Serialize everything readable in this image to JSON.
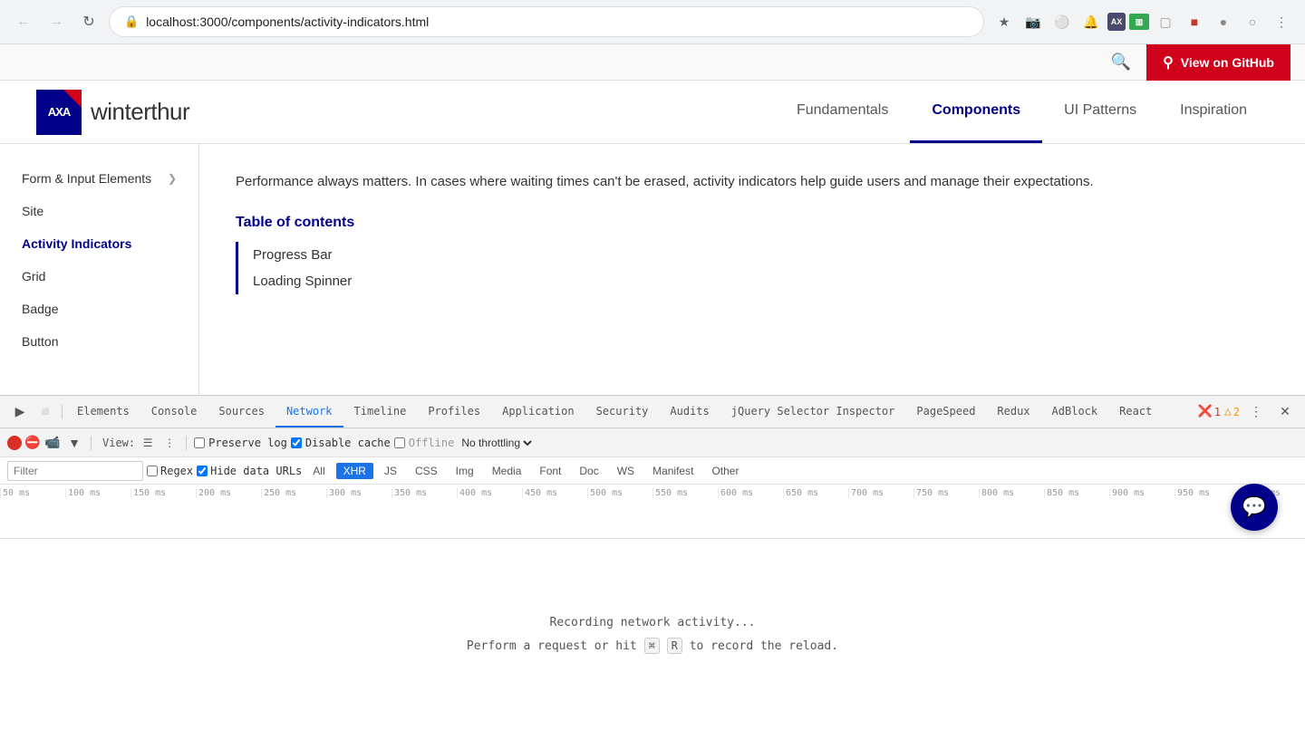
{
  "browser": {
    "url": "localhost:3000/components/activity-indicators.html",
    "back_disabled": true,
    "forward_disabled": true
  },
  "utility_bar": {
    "search_label": "🔍",
    "github_btn_label": "View on GitHub"
  },
  "header": {
    "logo_text": "winterthur",
    "nav_items": [
      {
        "id": "fundamentals",
        "label": "Fundamentals",
        "active": false
      },
      {
        "id": "components",
        "label": "Components",
        "active": true
      },
      {
        "id": "ui-patterns",
        "label": "UI Patterns",
        "active": false
      },
      {
        "id": "inspiration",
        "label": "Inspiration",
        "active": false
      }
    ]
  },
  "sidebar": {
    "items": [
      {
        "id": "form-input",
        "label": "Form & Input Elements",
        "has_chevron": true,
        "active": false
      },
      {
        "id": "site",
        "label": "Site",
        "active": false
      },
      {
        "id": "activity-indicators",
        "label": "Activity Indicators",
        "active": true
      },
      {
        "id": "grid",
        "label": "Grid",
        "active": false
      },
      {
        "id": "badge",
        "label": "Badge",
        "active": false
      },
      {
        "id": "button",
        "label": "Button",
        "active": false
      }
    ]
  },
  "content": {
    "intro": "Performance always matters. In cases where waiting times can't be erased, activity indicators help guide users and manage their expectations.",
    "toc_title": "Table of contents",
    "toc_items": [
      {
        "id": "progress-bar",
        "label": "Progress Bar"
      },
      {
        "id": "loading-spinner",
        "label": "Loading Spinner"
      }
    ]
  },
  "chat_btn": "💬",
  "devtools": {
    "tabs": [
      {
        "id": "elements",
        "label": "Elements",
        "active": false
      },
      {
        "id": "console",
        "label": "Console",
        "active": false
      },
      {
        "id": "sources",
        "label": "Sources",
        "active": false
      },
      {
        "id": "network",
        "label": "Network",
        "active": true
      },
      {
        "id": "timeline",
        "label": "Timeline",
        "active": false
      },
      {
        "id": "profiles",
        "label": "Profiles",
        "active": false
      },
      {
        "id": "application",
        "label": "Application",
        "active": false
      },
      {
        "id": "security",
        "label": "Security",
        "active": false
      },
      {
        "id": "audits",
        "label": "Audits",
        "active": false
      },
      {
        "id": "jquery-selector-inspector",
        "label": "jQuery Selector Inspector",
        "active": false
      },
      {
        "id": "pagespeed",
        "label": "PageSpeed",
        "active": false
      },
      {
        "id": "redux",
        "label": "Redux",
        "active": false
      },
      {
        "id": "adblock",
        "label": "AdBlock",
        "active": false
      },
      {
        "id": "react",
        "label": "React",
        "active": false
      }
    ],
    "error_count": "1",
    "warning_count": "2",
    "network_toolbar": {
      "view_label": "View:",
      "preserve_log_label": "Preserve log",
      "preserve_log_checked": false,
      "disable_cache_label": "Disable cache",
      "disable_cache_checked": true,
      "offline_label": "Offline",
      "offline_checked": false,
      "throttle_label": "No throttling"
    },
    "filter_bar": {
      "placeholder": "Filter",
      "regex_label": "Regex",
      "regex_checked": false,
      "hide_data_urls_label": "Hide data URLs",
      "hide_data_urls_checked": true,
      "filter_tags": [
        {
          "id": "all",
          "label": "All",
          "active": false
        },
        {
          "id": "xhr",
          "label": "XHR",
          "active": true
        },
        {
          "id": "js",
          "label": "JS",
          "active": false
        },
        {
          "id": "css",
          "label": "CSS",
          "active": false
        },
        {
          "id": "img",
          "label": "Img",
          "active": false
        },
        {
          "id": "media",
          "label": "Media",
          "active": false
        },
        {
          "id": "font",
          "label": "Font",
          "active": false
        },
        {
          "id": "doc",
          "label": "Doc",
          "active": false
        },
        {
          "id": "ws",
          "label": "WS",
          "active": false
        },
        {
          "id": "manifest",
          "label": "Manifest",
          "active": false
        },
        {
          "id": "other",
          "label": "Other",
          "active": false
        }
      ]
    },
    "timeline_ticks": [
      "50 ms",
      "100 ms",
      "150 ms",
      "200 ms",
      "250 ms",
      "300 ms",
      "350 ms",
      "400 ms",
      "450 ms",
      "500 ms",
      "550 ms",
      "600 ms",
      "650 ms",
      "700 ms",
      "750 ms",
      "800 ms",
      "850 ms",
      "900 ms",
      "950 ms",
      "1000 ms"
    ],
    "empty_state": {
      "line1": "Recording network activity...",
      "line2": "Perform a request or hit",
      "key_symbol": "⌘",
      "key_r": "R",
      "line2_end": "to record the reload."
    }
  }
}
